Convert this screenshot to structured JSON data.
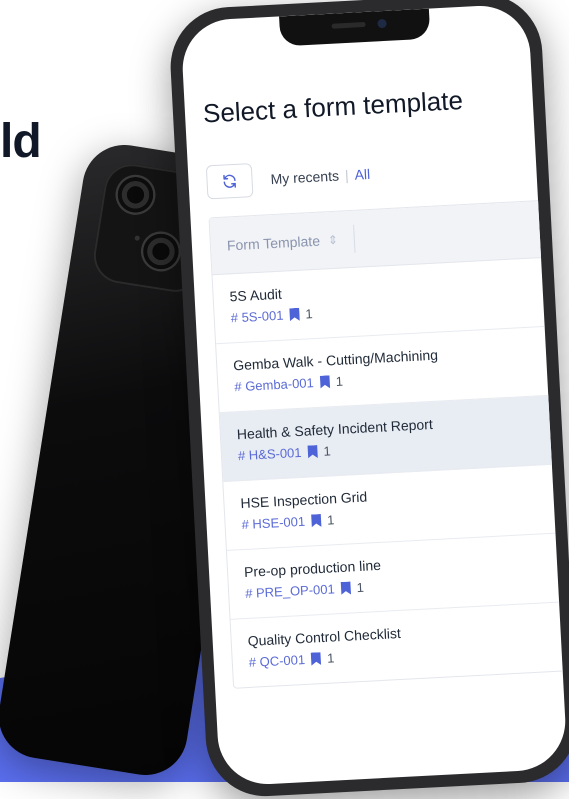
{
  "hero_text": "ld",
  "screen": {
    "title": "Select a form template",
    "tabs": {
      "recents": "My recents",
      "separator": "|",
      "all": "All"
    },
    "icons": {
      "refresh": "refresh-icon",
      "sort": "sort-icon",
      "bookmark": "bookmark-icon"
    },
    "table": {
      "column_header": "Form Template",
      "rows": [
        {
          "title": "5S Audit",
          "code": "# 5S-001",
          "count": "1",
          "selected": false
        },
        {
          "title": "Gemba Walk - Cutting/Machining",
          "code": "# Gemba-001",
          "count": "1",
          "selected": false
        },
        {
          "title": "Health & Safety Incident Report",
          "code": "# H&S-001",
          "count": "1",
          "selected": true
        },
        {
          "title": "HSE Inspection Grid",
          "code": "# HSE-001",
          "count": "1",
          "selected": false
        },
        {
          "title": "Pre-op production line",
          "code": "# PRE_OP-001",
          "count": "1",
          "selected": false
        },
        {
          "title": "Quality Control Checklist",
          "code": "# QC-001",
          "count": "1",
          "selected": false
        }
      ]
    }
  },
  "colors": {
    "accent": "#4f63d8",
    "band": "#5b6ff0",
    "selected_row": "#e8ecf3"
  }
}
